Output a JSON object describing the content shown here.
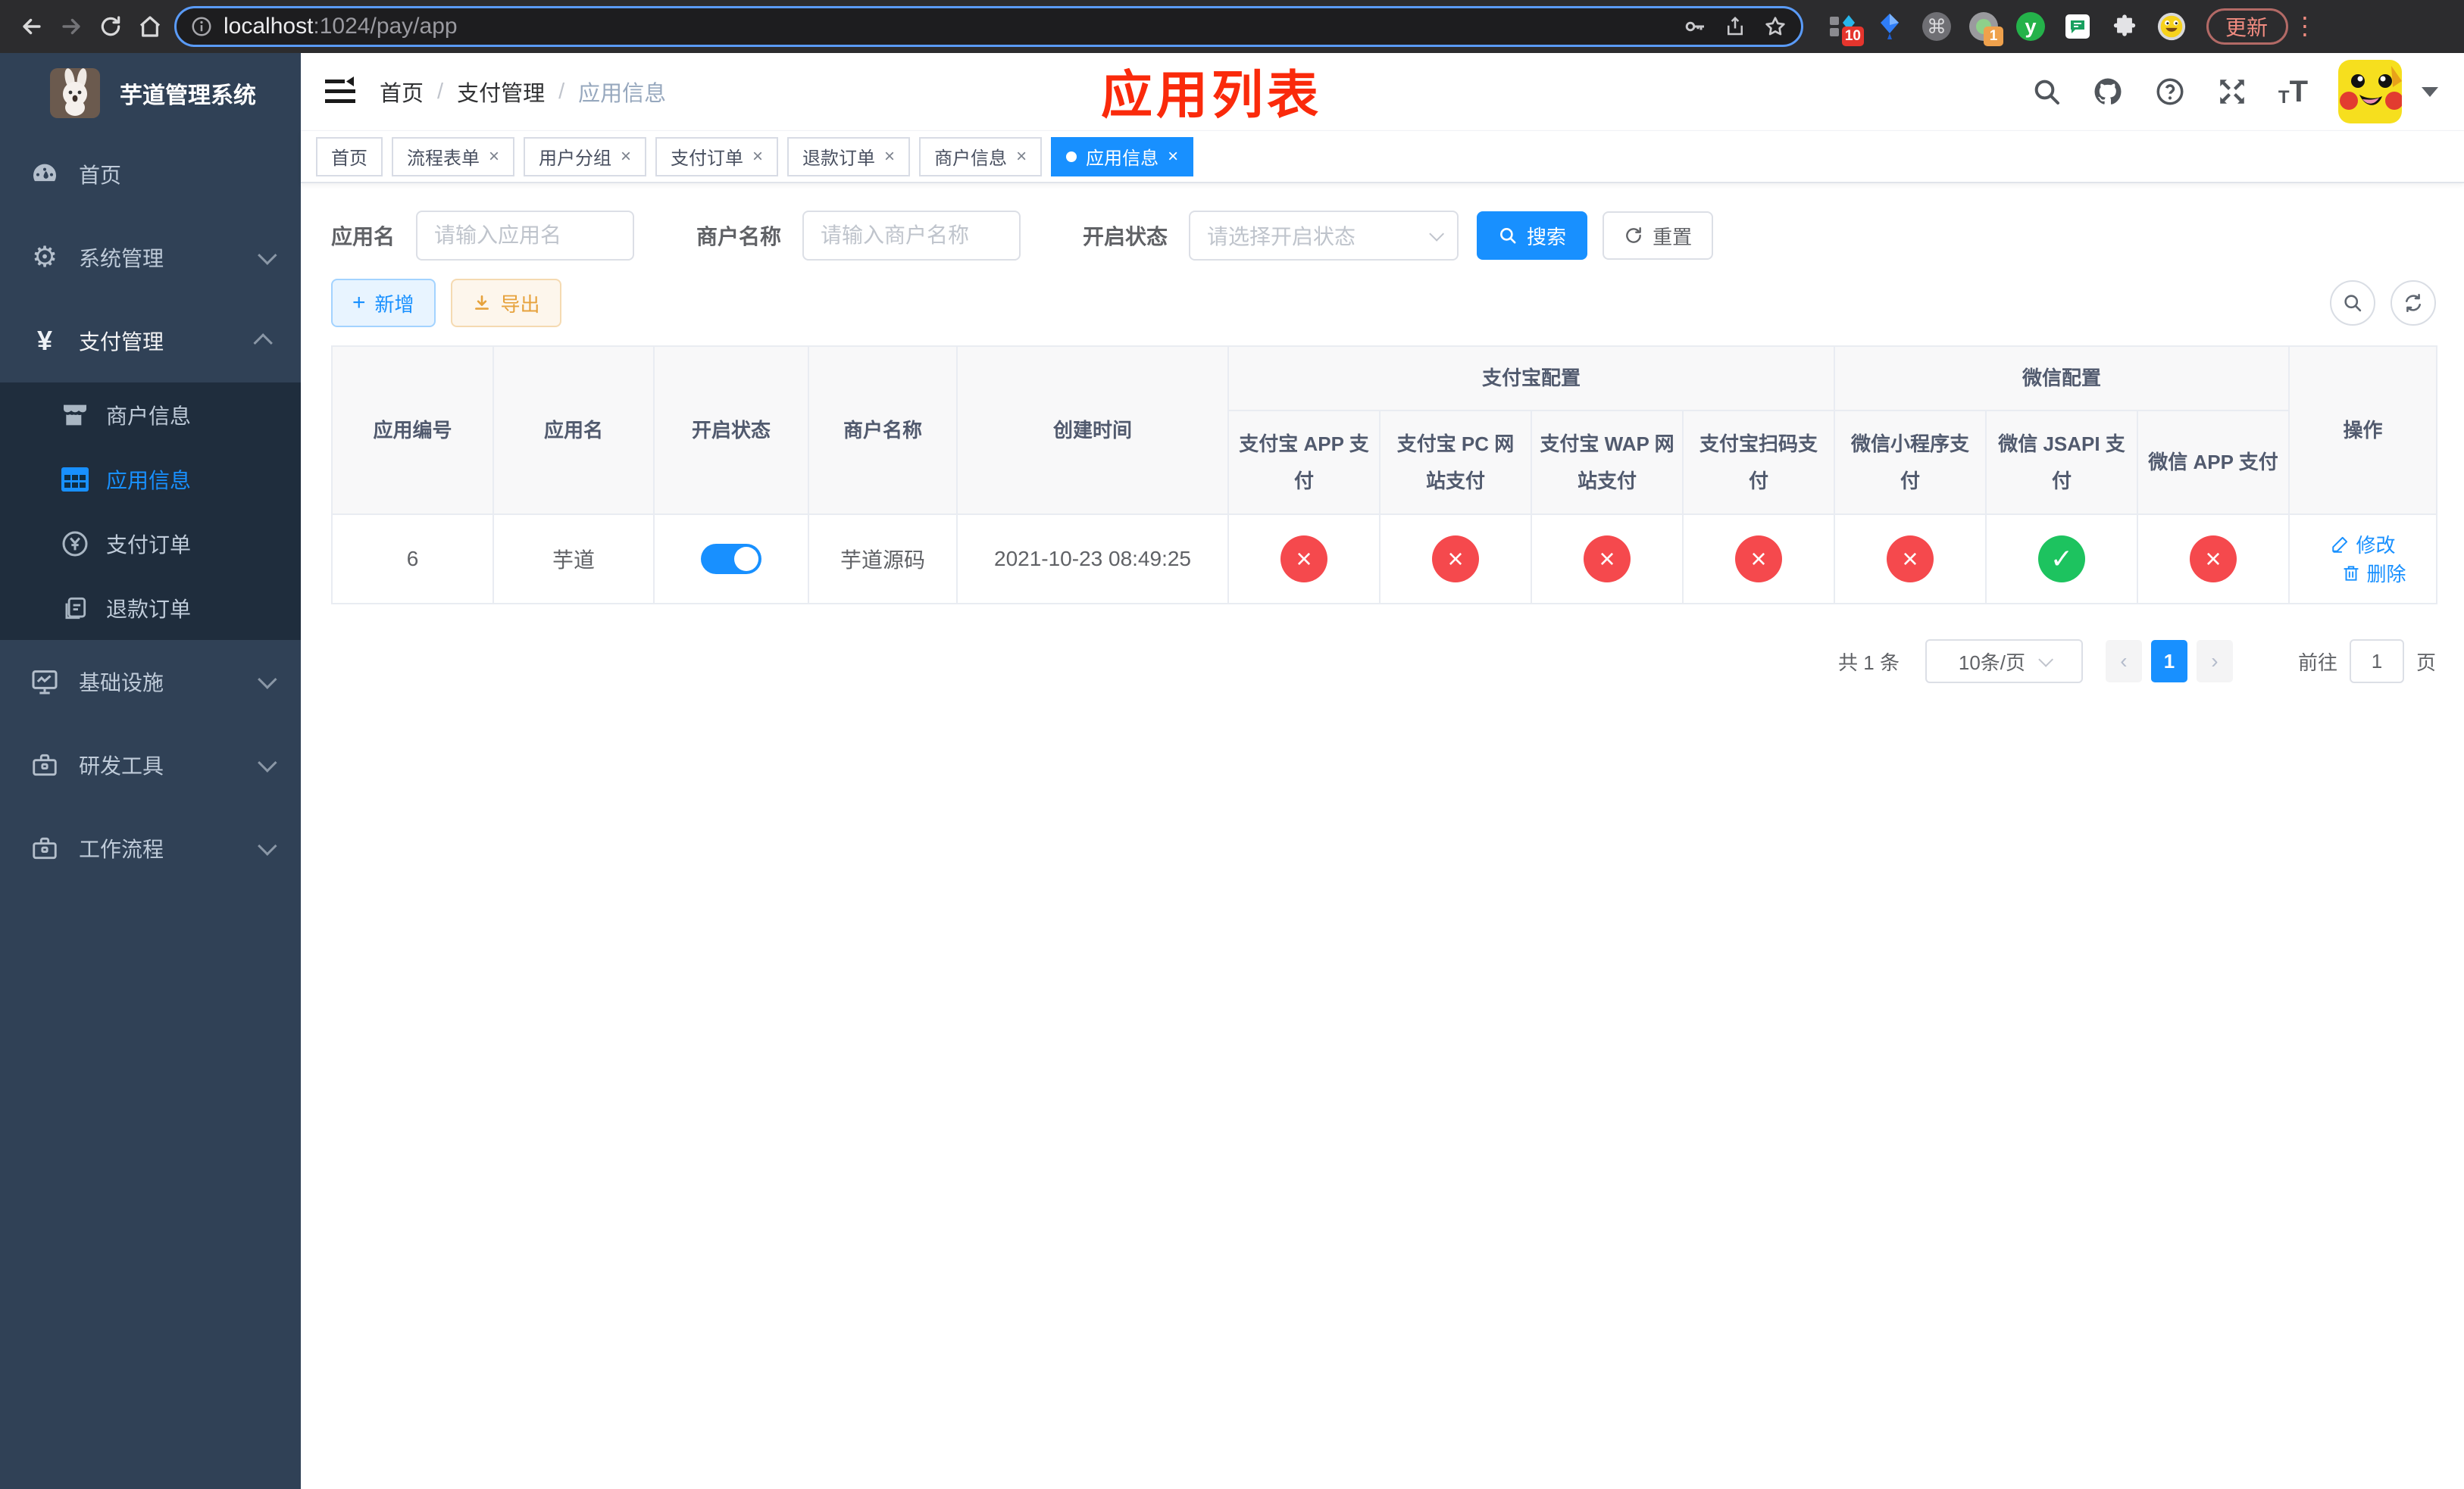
{
  "browser": {
    "url_domain": "localhost",
    "url_rest": ":1024/pay/app",
    "update_label": "更新",
    "ext_vue_badge": "10",
    "ext_proxy_badge": "1",
    "ext_y_letter": "y"
  },
  "sidebar": {
    "title": "芋道管理系统",
    "home": "首页",
    "system": "系统管理",
    "payment": "支付管理",
    "merchant_info": "商户信息",
    "app_info": "应用信息",
    "pay_order": "支付订单",
    "refund_order": "退款订单",
    "infrastructure": "基础设施",
    "dev_tools": "研发工具",
    "workflow": "工作流程"
  },
  "header": {
    "breadcrumb_home": "首页",
    "breadcrumb_section": "支付管理",
    "breadcrumb_current": "应用信息",
    "annotation": "应用列表"
  },
  "tabs": [
    {
      "label": "首页",
      "closable": false,
      "active": false
    },
    {
      "label": "流程表单",
      "closable": true,
      "active": false
    },
    {
      "label": "用户分组",
      "closable": true,
      "active": false
    },
    {
      "label": "支付订单",
      "closable": true,
      "active": false
    },
    {
      "label": "退款订单",
      "closable": true,
      "active": false
    },
    {
      "label": "商户信息",
      "closable": true,
      "active": false
    },
    {
      "label": "应用信息",
      "closable": true,
      "active": true
    }
  ],
  "filter": {
    "app_name_label": "应用名",
    "app_name_placeholder": "请输入应用名",
    "merchant_label": "商户名称",
    "merchant_placeholder": "请输入商户名称",
    "status_label": "开启状态",
    "status_placeholder": "请选择开启状态",
    "search_label": "搜索",
    "reset_label": "重置"
  },
  "toolbar": {
    "add_label": "新增",
    "export_label": "导出"
  },
  "table": {
    "headers": {
      "app_id": "应用编号",
      "app_name": "应用名",
      "status": "开启状态",
      "merchant": "商户名称",
      "create_time": "创建时间",
      "alipay_group": "支付宝配置",
      "wechat_group": "微信配置",
      "actions": "操作",
      "alipay_app": "支付宝 APP 支付",
      "alipay_pc": "支付宝 PC 网站支付",
      "alipay_wap": "支付宝 WAP 网站支付",
      "alipay_qr": "支付宝扫码支付",
      "wx_lite": "微信小程序支付",
      "wx_jsapi": "微信 JSAPI 支付",
      "wx_app": "微信 APP 支付"
    },
    "rows": [
      {
        "app_id": "6",
        "app_name": "芋道",
        "status_on": true,
        "merchant": "芋道源码",
        "create_time": "2021-10-23 08:49:25",
        "channels": [
          false,
          false,
          false,
          false,
          false,
          true,
          false
        ],
        "edit_label": "修改",
        "delete_label": "删除"
      }
    ]
  },
  "pagination": {
    "total_text": "共 1 条",
    "page_size_text": "10条/页",
    "current_page": "1",
    "goto_label": "前往",
    "goto_value": "1",
    "page_unit": "页"
  },
  "colors": {
    "primary": "#1890ff",
    "success": "#1dc35f",
    "danger": "#f5494d",
    "warning": "#e6a23c",
    "sidebar_bg": "#304156",
    "submenu_bg": "#1f2d3d",
    "annotation_red": "#fa2a0b"
  }
}
